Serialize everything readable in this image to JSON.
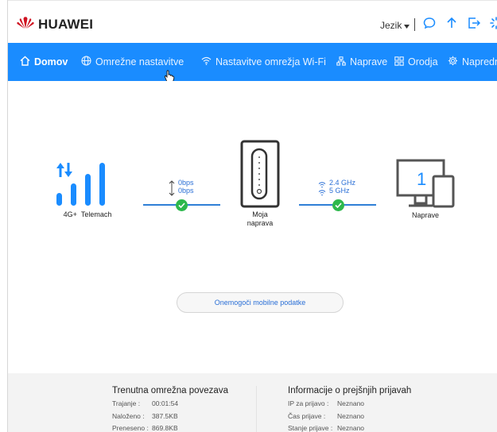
{
  "brand": {
    "name": "HUAWEI",
    "logo_icon": "huawei-logo-icon",
    "color": "#cf1322"
  },
  "header": {
    "language_label": "Jezik",
    "icons": [
      "chat-icon",
      "upload-arrow-icon",
      "logout-icon",
      "loading-icon"
    ]
  },
  "nav": {
    "accent": "#1a8cff",
    "items": [
      {
        "label": "Domov",
        "icon": "home-icon",
        "active": true
      },
      {
        "label": "Omrežne nastavitve",
        "icon": "globe-icon"
      },
      {
        "label": "Nastavitve omrežja Wi-Fi",
        "icon": "wifi-icon"
      },
      {
        "label": "Naprave",
        "icon": "devices-icon"
      },
      {
        "label": "Orodja",
        "icon": "tools-icon"
      },
      {
        "label": "Napredno",
        "icon": "gear-icon"
      }
    ]
  },
  "status": {
    "network_type": "4G+",
    "operator": "Telemach",
    "upload_speed": "0bps",
    "download_speed": "0bps",
    "device_label_line1": "Moja",
    "device_label_line2": "naprava",
    "wifi_band_1": "2.4 GHz",
    "wifi_band_2": "5 GHz",
    "connected_devices_count": "1",
    "devices_label": "Naprave",
    "status_color": "#2db84c"
  },
  "mobile_data_button": "Onemogoči mobilne podatke",
  "current_connection": {
    "title": "Trenutna omrežna povezava",
    "rows": [
      {
        "key": "Trajanje :",
        "value": "00:01:54"
      },
      {
        "key": "Naloženo :",
        "value": "387.5KB"
      },
      {
        "key": "Preneseno :",
        "value": "869.8KB"
      }
    ]
  },
  "previous_login": {
    "title": "Informacije o prejšnjih prijavah",
    "rows": [
      {
        "key": "IP za prijavo :",
        "value": "Neznano"
      },
      {
        "key": "Čas prijave :",
        "value": "Neznano"
      },
      {
        "key": "Stanje prijave :",
        "value": "Neznano"
      }
    ]
  }
}
